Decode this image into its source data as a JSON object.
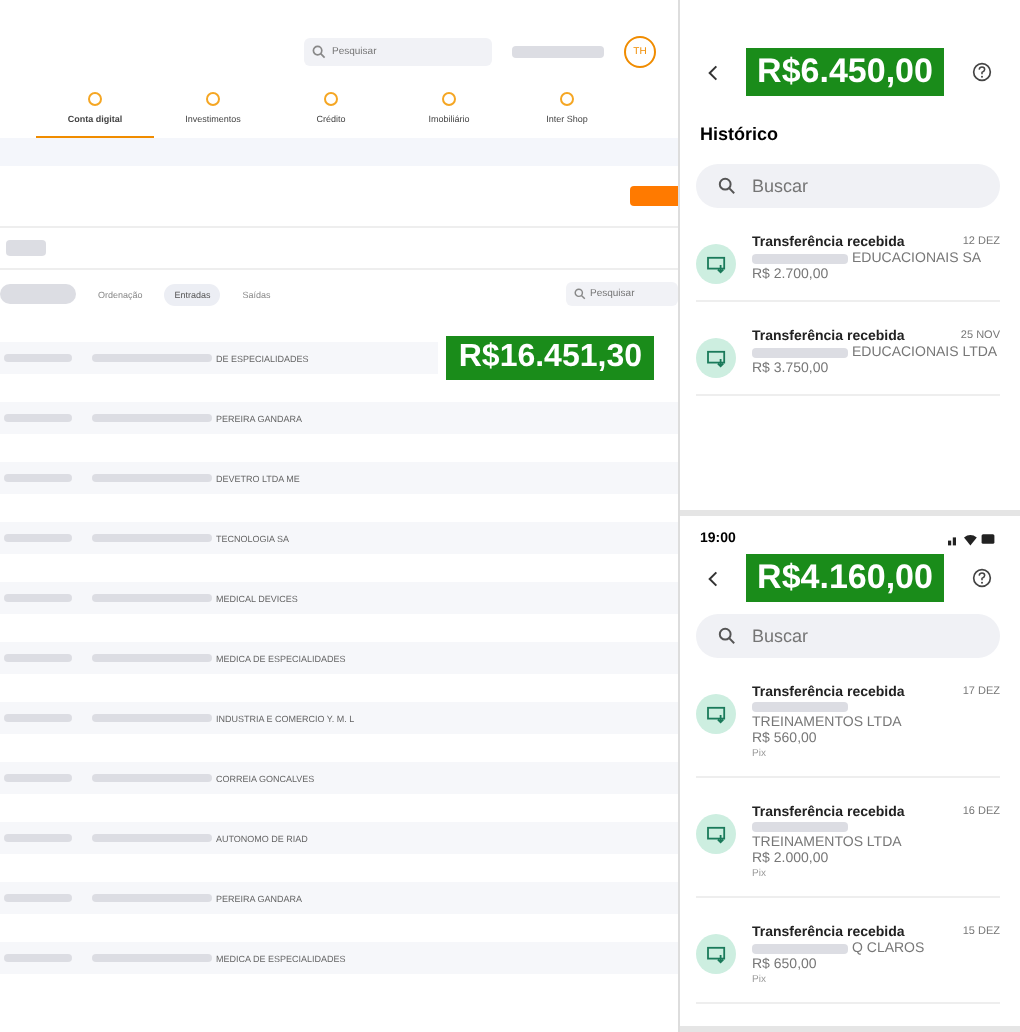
{
  "desktop": {
    "search": {
      "placeholder": "Pesquisar"
    },
    "avatar": "TH",
    "tabs": [
      {
        "label": "Conta digital",
        "selected": true
      },
      {
        "label": "Investimentos",
        "selected": false
      },
      {
        "label": "Crédito",
        "selected": false
      },
      {
        "label": "Imobiliário",
        "selected": false
      },
      {
        "label": "Inter Shop",
        "selected": false
      }
    ],
    "filters": [
      {
        "label": "Ordenação",
        "selected": false
      },
      {
        "label": "Entradas",
        "selected": true
      },
      {
        "label": "Saídas",
        "selected": false
      }
    ],
    "list_search": {
      "placeholder": "Pesquisar"
    },
    "highlight": "R$16.451,30",
    "rows": [
      {
        "name": "DE ESPECIALIDADES"
      },
      {
        "name": "PEREIRA GANDARA"
      },
      {
        "name": "DEVETRO LTDA ME"
      },
      {
        "name": "TECNOLOGIA SA"
      },
      {
        "name": "MEDICAL DEVICES"
      },
      {
        "name": "MEDICA DE ESPECIALIDADES"
      },
      {
        "name": "INDUSTRIA E COMERCIO Y. M. L"
      },
      {
        "name": "CORREIA GONCALVES"
      },
      {
        "name": "AUTONOMO DE RIAD"
      },
      {
        "name": "PEREIRA GANDARA"
      },
      {
        "name": "MEDICA DE ESPECIALIDADES"
      }
    ]
  },
  "phones": [
    {
      "highlight": "R$6.450,00",
      "heading": "Histórico",
      "search": {
        "placeholder": "Buscar"
      },
      "items": [
        {
          "title": "Transferência recebida",
          "date": "12 DEZ",
          "name": "EDUCACIONAIS SA",
          "amount": "R$ 2.700,00"
        },
        {
          "title": "Transferência recebida",
          "date": "25 NOV",
          "name": "EDUCACIONAIS LTDA",
          "amount": "R$ 3.750,00"
        }
      ]
    },
    {
      "status_time": "19:00",
      "highlight": "R$4.160,00",
      "search": {
        "placeholder": "Buscar"
      },
      "items": [
        {
          "title": "Transferência recebida",
          "date": "17 DEZ",
          "name": "TREINAMENTOS LTDA",
          "amount": "R$ 560,00",
          "method": "Pix"
        },
        {
          "title": "Transferência recebida",
          "date": "16 DEZ",
          "name": "TREINAMENTOS LTDA",
          "amount": "R$ 2.000,00",
          "method": "Pix"
        },
        {
          "title": "Transferência recebida",
          "date": "15 DEZ",
          "name": "Q CLAROS",
          "amount": "R$ 650,00",
          "method": "Pix"
        }
      ]
    }
  ]
}
